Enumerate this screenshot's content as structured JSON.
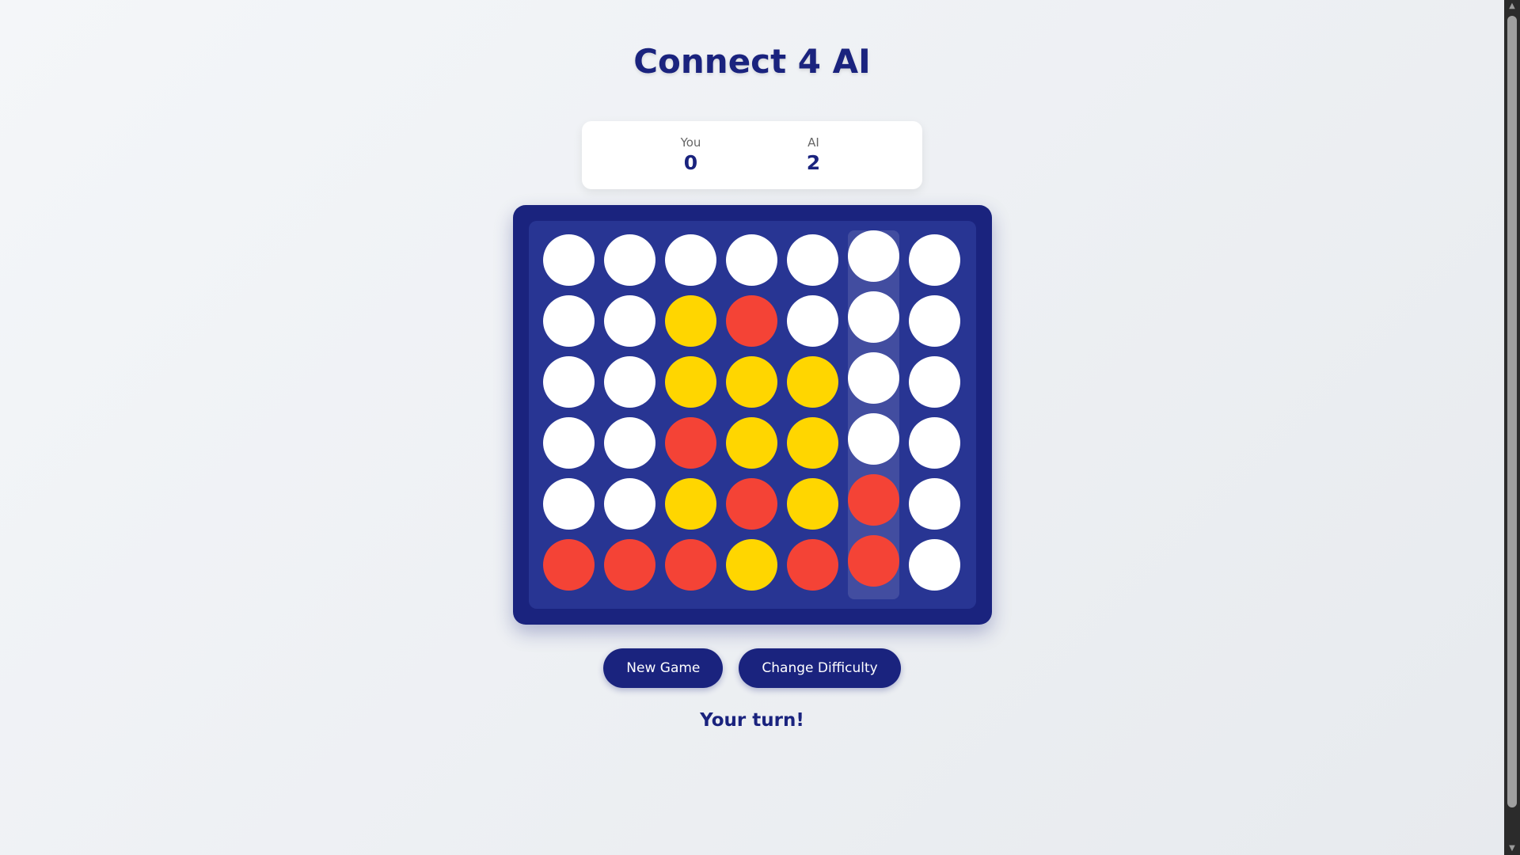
{
  "app": {
    "title": "Connect 4 AI"
  },
  "scoreboard": {
    "player": {
      "label": "You",
      "score": "0"
    },
    "ai": {
      "label": "AI",
      "score": "2"
    }
  },
  "board": {
    "columns": 7,
    "rows": 6,
    "hovered_column": 5,
    "grid": [
      [
        "empty",
        "empty",
        "empty",
        "empty",
        "empty",
        "empty",
        "empty"
      ],
      [
        "empty",
        "empty",
        "yellow",
        "red",
        "empty",
        "empty",
        "empty"
      ],
      [
        "empty",
        "empty",
        "yellow",
        "yellow",
        "yellow",
        "empty",
        "empty"
      ],
      [
        "empty",
        "empty",
        "red",
        "yellow",
        "yellow",
        "empty",
        "empty"
      ],
      [
        "empty",
        "empty",
        "yellow",
        "red",
        "yellow",
        "red",
        "empty"
      ],
      [
        "red",
        "red",
        "red",
        "yellow",
        "red",
        "red",
        "empty"
      ]
    ],
    "colors": {
      "frame": "#1a237e",
      "inner": "#283593",
      "red": "#f44336",
      "yellow": "#ffd600",
      "empty": "#ffffff"
    }
  },
  "controls": {
    "new_game_label": "New Game",
    "change_difficulty_label": "Change Difficulty"
  },
  "status": {
    "message": "Your turn!"
  },
  "icons": {
    "scroll_up": "triangle-up-icon",
    "scroll_down": "triangle-down-icon"
  }
}
